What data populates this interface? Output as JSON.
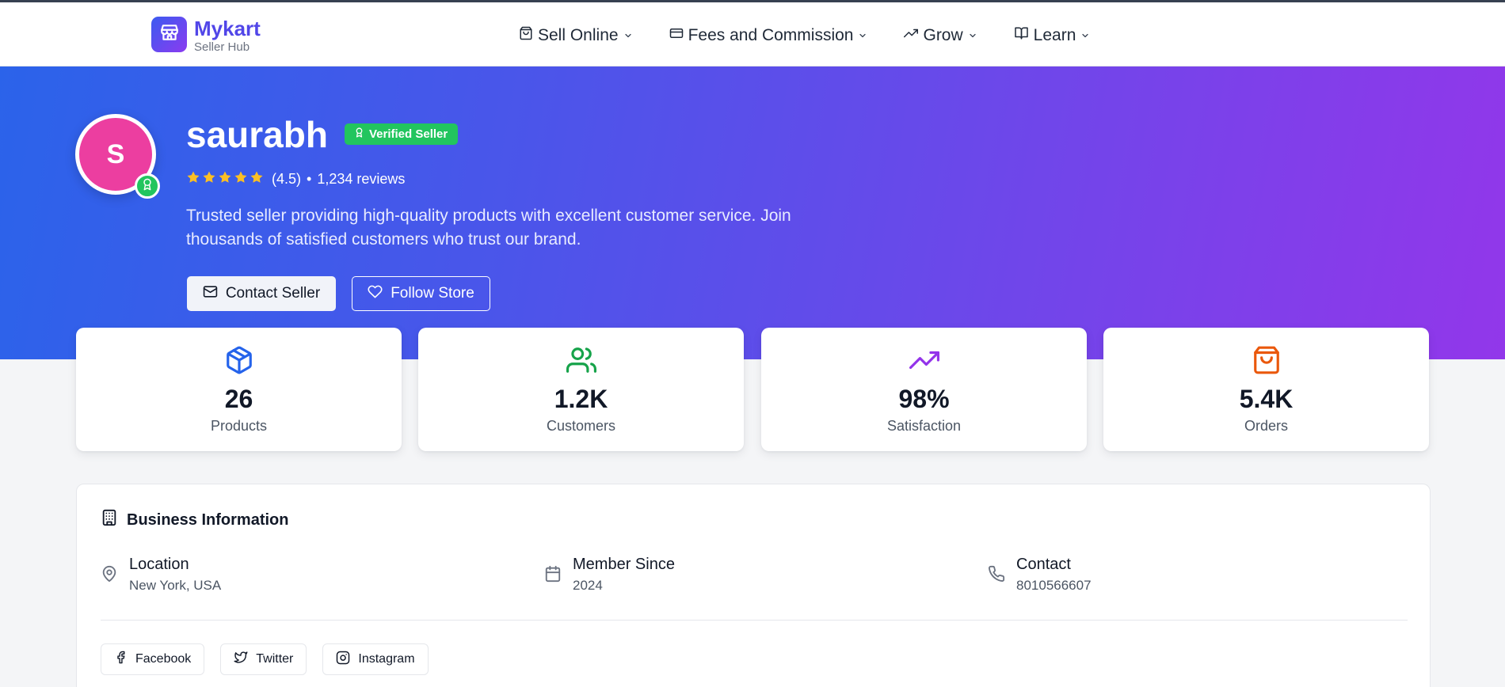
{
  "brand": {
    "name": "Mykart",
    "subtitle": "Seller Hub",
    "logo_icon": "store-icon"
  },
  "nav": {
    "items": [
      {
        "label": "Sell Online",
        "icon": "shopping-bag-icon"
      },
      {
        "label": "Fees and Commission",
        "icon": "credit-card-icon"
      },
      {
        "label": "Grow",
        "icon": "trending-up-icon"
      },
      {
        "label": "Learn",
        "icon": "book-open-icon"
      }
    ]
  },
  "profile": {
    "avatar_initial": "S",
    "name": "saurabh",
    "verified_label": "Verified Seller",
    "rating": "(4.5)",
    "separator": "•",
    "reviews": "1,234 reviews",
    "star_count": 5,
    "description": "Trusted seller providing high-quality products with excellent customer service. Join thousands of satisfied customers who trust our brand.",
    "contact_button": "Contact Seller",
    "follow_button": "Follow Store"
  },
  "stats": [
    {
      "value": "26",
      "label": "Products",
      "icon": "package-icon",
      "color": "#2563eb"
    },
    {
      "value": "1.2K",
      "label": "Customers",
      "icon": "users-icon",
      "color": "#16a34a"
    },
    {
      "value": "98%",
      "label": "Satisfaction",
      "icon": "trending-up-icon",
      "color": "#9333ea"
    },
    {
      "value": "5.4K",
      "label": "Orders",
      "icon": "shopping-bag-icon",
      "color": "#ea580c"
    }
  ],
  "business": {
    "title": "Business Information",
    "location": {
      "label": "Location",
      "value": "New York, USA"
    },
    "member_since": {
      "label": "Member Since",
      "value": "2024"
    },
    "contact": {
      "label": "Contact",
      "value": "8010566607"
    },
    "social": [
      {
        "label": "Facebook",
        "icon": "facebook-icon"
      },
      {
        "label": "Twitter",
        "icon": "twitter-icon"
      },
      {
        "label": "Instagram",
        "icon": "instagram-icon"
      }
    ]
  },
  "colors": {
    "brand_gradient_start": "#3b5bf0",
    "brand_gradient_end": "#8b3bf0",
    "hero_gradient_start": "#2b63ea",
    "hero_gradient_end": "#9237ea",
    "verified_green": "#22c55e",
    "avatar_pink": "#ec3ea0",
    "star_yellow": "#fbbf24"
  }
}
